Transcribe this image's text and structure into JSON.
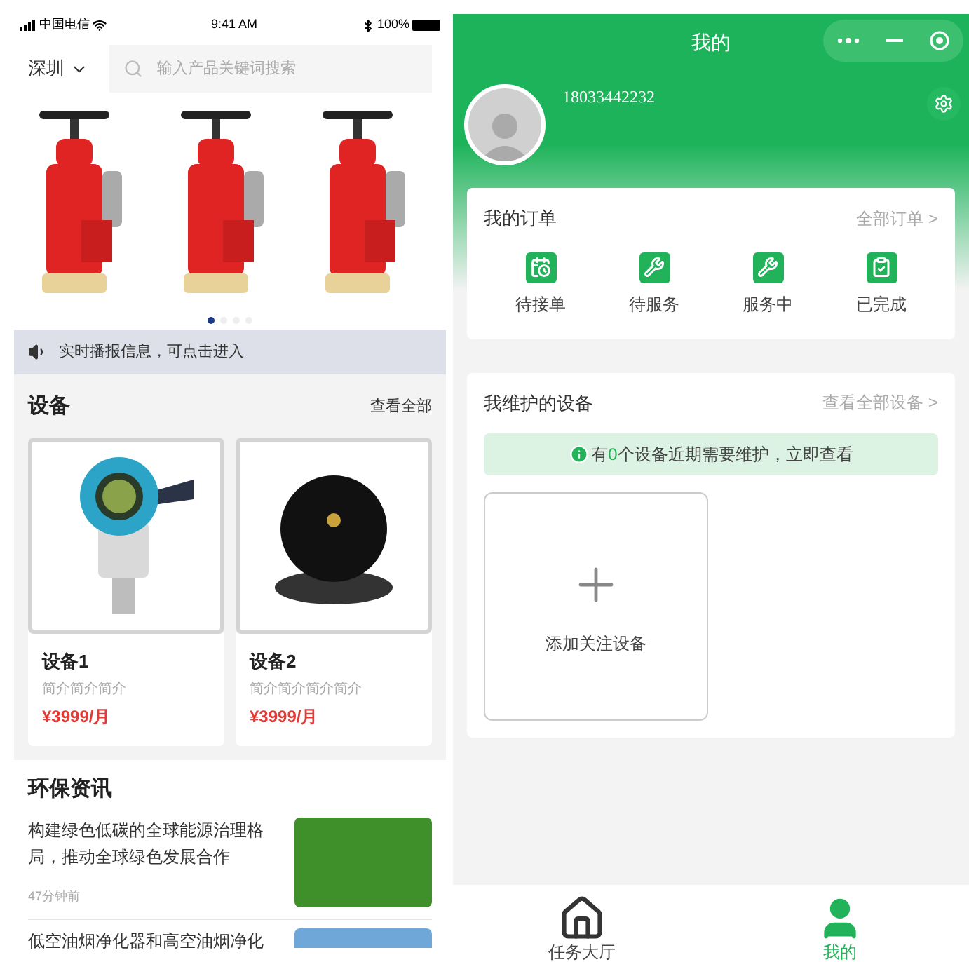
{
  "left": {
    "status_bar": {
      "carrier": "中国电信",
      "time": "9:41 AM",
      "battery": "100%"
    },
    "location": {
      "city": "深圳"
    },
    "search": {
      "placeholder": "输入产品关键词搜索"
    },
    "banner": {
      "dots": [
        {
          "selected": true
        },
        {
          "selected": false
        },
        {
          "selected": false
        },
        {
          "selected": false
        }
      ]
    },
    "notice": {
      "text": "实时播报信息，可点击进入"
    },
    "devices": {
      "title": "设备",
      "more": "查看全部",
      "items": [
        {
          "name": "设备1",
          "desc": "简介简介简介",
          "price": "¥3999/月",
          "kind": "transmitter"
        },
        {
          "name": "设备2",
          "desc": "简介简介简介简介",
          "price": "¥3999/月",
          "kind": "camera"
        }
      ]
    },
    "news": {
      "title": "环保资讯",
      "items": [
        {
          "title": "构建绿色低碳的全球能源治理格局，推动全球绿色发展合作",
          "time": "47分钟前",
          "kind": "forest"
        },
        {
          "title": "低空油烟净化器和高空油烟净化",
          "kind": "sky"
        }
      ]
    }
  },
  "right": {
    "header": {
      "title": "我的"
    },
    "profile": {
      "phone": "18033442232"
    },
    "orders": {
      "title": "我的订单",
      "more": "全部订单 >",
      "items": [
        {
          "label": "待接单",
          "kind": "calendar"
        },
        {
          "label": "待服务",
          "kind": "wrench"
        },
        {
          "label": "服务中",
          "kind": "wrench"
        },
        {
          "label": "已完成",
          "kind": "clipboard"
        }
      ]
    },
    "maintained": {
      "title": "我维护的设备",
      "more": "查看全部设备 >",
      "alert": {
        "before": "有",
        "count": "0",
        "after": "个设备近期需要维护，立即查看"
      },
      "add_label": "添加关注设备"
    },
    "tabbar": [
      {
        "label": "任务大厅",
        "kind": "home",
        "selected": false
      },
      {
        "label": "我的",
        "kind": "user",
        "selected": true
      }
    ]
  }
}
